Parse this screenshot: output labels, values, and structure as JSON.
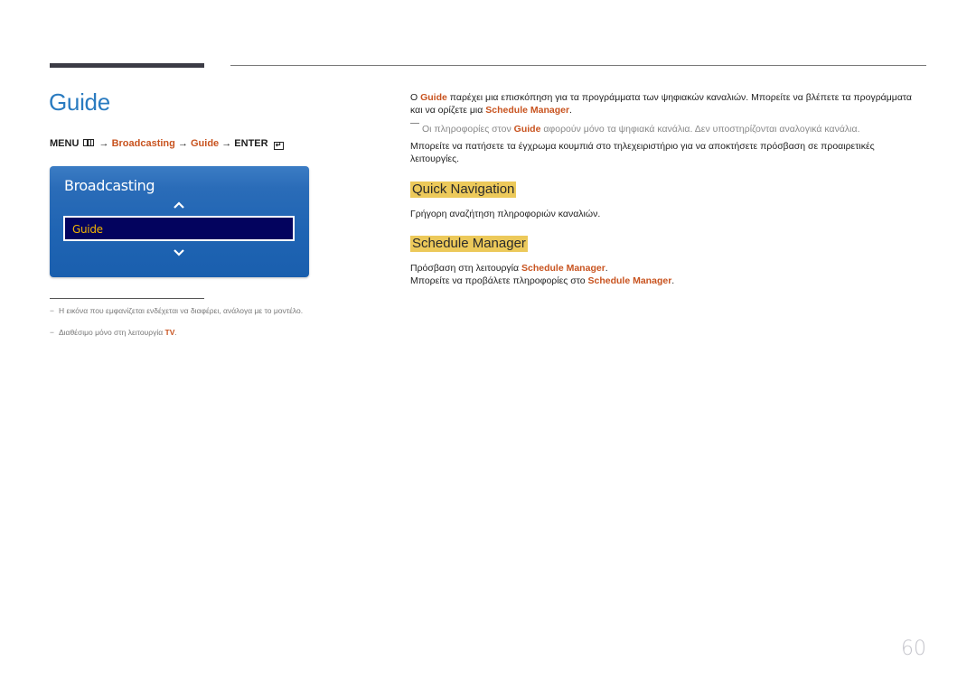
{
  "page": {
    "title": "Guide",
    "page_number": "60"
  },
  "menu_path": {
    "menu": "MENU",
    "arrow": "→",
    "step1": "Broadcasting",
    "step2": "Guide",
    "enter": "ENTER",
    "menu_icon": "menu-grid-icon",
    "enter_icon": "enter-icon"
  },
  "osd": {
    "title": "Broadcasting",
    "selected_item": "Guide",
    "up_icon": "chevron-up-icon",
    "down_icon": "chevron-down-icon"
  },
  "notes": [
    {
      "dash": "−",
      "text": "Η εικόνα που εμφανίζεται ενδέχεται να διαφέρει, ανάλογα με το μοντέλο."
    },
    {
      "dash": "−",
      "text_before": "Διαθέσιμο μόνο στη λειτουργία ",
      "highlight": "TV",
      "text_after": "."
    }
  ],
  "intro": {
    "p1_before": "Ο ",
    "p1_hl1": "Guide",
    "p1_mid": " παρέχει μια επισκόπηση για τα προγράμματα των ψηφιακών καναλιών. Μπορείτε να βλέπετε τα προγράμματα και να ορίζετε μια ",
    "p1_hl2": "Schedule Manager",
    "p1_after": ".",
    "note_before": "Οι πληροφορίες στον ",
    "note_hl": "Guide",
    "note_after": " αφορούν μόνο τα ψηφιακά κανάλια. Δεν υποστηρίζονται αναλογικά κανάλια.",
    "p2": "Μπορείτε να πατήσετε τα έγχρωμα κουμπιά στο τηλεχειριστήριο για να αποκτήσετε πρόσβαση σε προαιρετικές λειτουργίες."
  },
  "sections": {
    "quick_nav": {
      "heading": "Quick Navigation",
      "text": "Γρήγορη αναζήτηση πληροφοριών καναλιών."
    },
    "schedule_manager": {
      "heading": "Schedule Manager",
      "line1_before": "Πρόσβαση στη λειτουργία ",
      "line1_hl": "Schedule Manager",
      "line1_after": ".",
      "line2_before": "Μπορείτε να προβάλετε πληροφορίες στο ",
      "line2_hl": "Schedule Manager",
      "line2_after": "."
    }
  },
  "colors": {
    "title_blue": "#2a7bc0",
    "highlight_orange": "#c8531f",
    "heading_bg": "#ecc95a",
    "osd_blue": "#1f64b3",
    "osd_selected": "#03035e",
    "osd_selected_text": "#f0b400"
  }
}
